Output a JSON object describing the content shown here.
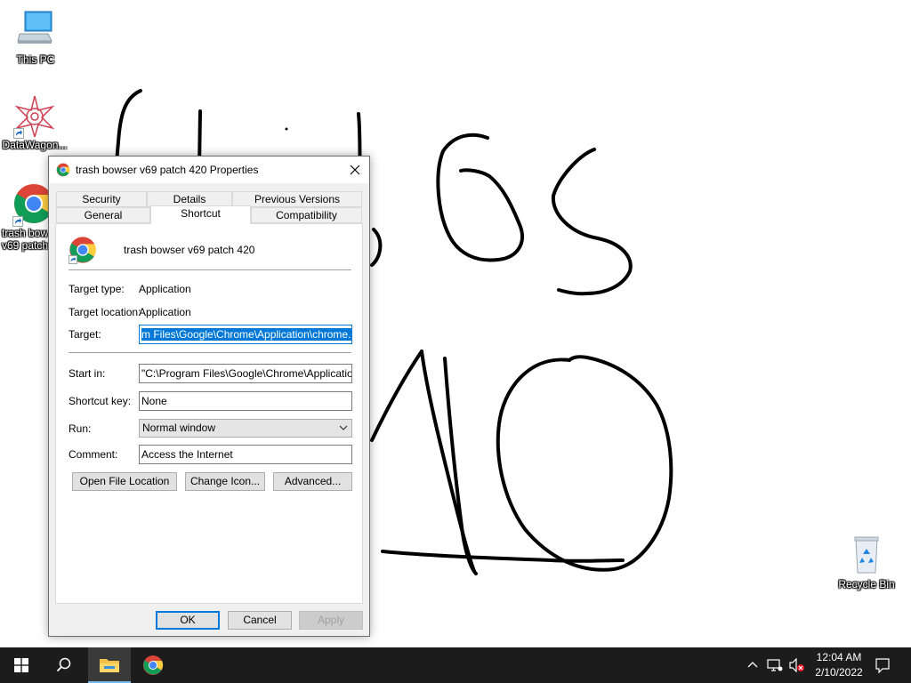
{
  "desktop": {
    "icons": [
      {
        "label": "This PC"
      },
      {
        "label": "DataWagon..."
      },
      {
        "label": "trash bow v69 patch"
      },
      {
        "label": "Recycle Bin"
      }
    ]
  },
  "dialog": {
    "title": "trash bowser v69 patch 420 Properties",
    "tabs_top": [
      "Security",
      "Details",
      "Previous Versions"
    ],
    "tabs_bottom": [
      "General",
      "Shortcut",
      "Compatibility"
    ],
    "active_tab": "Shortcut",
    "shortcut_name": "trash bowser v69 patch 420",
    "target_type_label": "Target type:",
    "target_type_value": "Application",
    "target_location_label": "Target location:",
    "target_location_value": "Application",
    "target_label": "Target:",
    "target_value": "m Files\\Google\\Chrome\\Application\\chrome.exe\"",
    "start_in_label": "Start in:",
    "start_in_value": "\"C:\\Program Files\\Google\\Chrome\\Application\"",
    "shortcut_key_label": "Shortcut key:",
    "shortcut_key_value": "None",
    "run_label": "Run:",
    "run_value": "Normal window",
    "comment_label": "Comment:",
    "comment_value": "Access the Internet",
    "open_file_location": "Open File Location",
    "change_icon": "Change Icon...",
    "advanced": "Advanced...",
    "ok": "OK",
    "cancel": "Cancel",
    "apply": "Apply"
  },
  "taskbar": {
    "time": "12:04 AM",
    "date": "2/10/2022",
    "accent": "#76b9ed"
  },
  "colors": {
    "selection": "#0078d7",
    "dialog_bg": "#f0f0f0",
    "taskbar_bg": "#1c1c1c"
  }
}
